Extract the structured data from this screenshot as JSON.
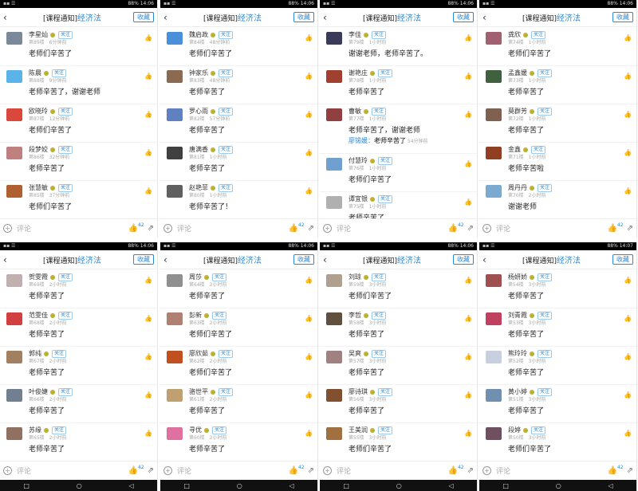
{
  "header": {
    "prefix": "[课程通知]",
    "course": "经济法",
    "fav": "收藏"
  },
  "statusbar": {
    "p1": "88% 14:06",
    "p2": "88% 14:06",
    "p3": "88% 14:06",
    "p4": "88% 14:06",
    "p5": "88% 14:06",
    "p6": "88% 14:06",
    "p7": "88% 14:06",
    "p8": "88% 14:07"
  },
  "follow": "关注",
  "bottom": {
    "placeholder": "评论",
    "likes": "42"
  },
  "panels": [
    {
      "comments": [
        {
          "name": "李星灿",
          "floor": "第89楼",
          "time": "6分钟前",
          "text": "老师们辛苦了",
          "color": "#7a8a9a"
        },
        {
          "name": "陈晨",
          "floor": "第88楼",
          "time": "9分钟前",
          "text": "老师辛苦了，谢谢老师",
          "color": "#5ab4e8"
        },
        {
          "name": "欧晓玲",
          "floor": "第87楼",
          "time": "12分钟前",
          "text": "老师们辛苦了",
          "color": "#d9483b"
        },
        {
          "name": "段梦姣",
          "floor": "第86楼",
          "time": "32分钟前",
          "text": "老师辛苦了",
          "color": "#c08080"
        },
        {
          "name": "张慧敏",
          "floor": "第85楼",
          "time": "37分钟前",
          "text": "老师们辛苦了",
          "color": "#b06030"
        }
      ]
    },
    {
      "comments": [
        {
          "name": "魏启政",
          "floor": "第84楼",
          "time": "48分钟前",
          "text": "老师们辛苦了",
          "color": "#4a90d9"
        },
        {
          "name": "钟家乐",
          "floor": "第83楼",
          "time": "48分钟前",
          "text": "老师辛苦了",
          "color": "#8a6a50"
        },
        {
          "name": "罗心雨",
          "floor": "第82楼",
          "time": "57分钟前",
          "text": "老师辛苦了",
          "color": "#6080c0"
        },
        {
          "name": "唐满香",
          "floor": "第81楼",
          "time": "1小时前",
          "text": "老师辛苦了",
          "color": "#404040"
        },
        {
          "name": "赵艳菲",
          "floor": "第80楼",
          "time": "1小时前",
          "text": "老师辛苦了！",
          "color": "#606060"
        }
      ]
    },
    {
      "comments": [
        {
          "name": "李佳",
          "floor": "第79楼",
          "time": "1小时前",
          "text": "谢谢老师，老师辛苦了。",
          "color": "#3a3a5a"
        },
        {
          "name": "谢艳庄",
          "floor": "第78楼",
          "time": "1小时前",
          "text": "老师辛苦了",
          "color": "#a04030"
        },
        {
          "name": "曹敏",
          "floor": "第77楼",
          "time": "1小时前",
          "text": "老师辛苦了，谢谢老师",
          "color": "#904040",
          "reply": {
            "name": "廖锡媛：",
            "text": "老师辛苦了",
            "time": "54分钟前"
          }
        },
        {
          "name": "付慧玲",
          "floor": "第76楼",
          "time": "1小时前",
          "text": "老师们辛苦了",
          "color": "#70a0d0"
        },
        {
          "name": "谭宜银",
          "floor": "第75楼",
          "time": "1小时前",
          "text": "老师辛苦了",
          "color": "#b0b0b0"
        }
      ]
    },
    {
      "comments": [
        {
          "name": "龚欣",
          "floor": "第74楼",
          "time": "1小时前",
          "text": "老师们辛苦了",
          "color": "#a06070"
        },
        {
          "name": "孟鑫媛",
          "floor": "第73楼",
          "time": "1小时前",
          "text": "老师辛苦了",
          "color": "#406040"
        },
        {
          "name": "莫群芳",
          "floor": "第72楼",
          "time": "1小时前",
          "text": "老师辛苦了",
          "color": "#806050"
        },
        {
          "name": "金鑫",
          "floor": "第71楼",
          "time": "1小时前",
          "text": "老师辛苦啦",
          "color": "#904020"
        },
        {
          "name": "周丹丹",
          "floor": "第70楼",
          "time": "2小时前",
          "text": "谢谢老师",
          "color": "#7aaad0"
        }
      ]
    },
    {
      "comments": [
        {
          "name": "贺雯霞",
          "floor": "第69楼",
          "time": "2小时前",
          "text": "老师辛苦了",
          "color": "#c0b0b0"
        },
        {
          "name": "范雯佳",
          "floor": "第68楼",
          "time": "2小时前",
          "text": "老师辛苦了",
          "color": "#d04040"
        },
        {
          "name": "郭纯",
          "floor": "第67楼",
          "time": "2小时前",
          "text": "老师辛苦了",
          "color": "#a08060"
        },
        {
          "name": "叶俊婕",
          "floor": "第66楼",
          "time": "2小时前",
          "text": "老师辛苦了",
          "color": "#708090"
        },
        {
          "name": "苏缘",
          "floor": "第65楼",
          "time": "2小时前",
          "text": "老师辛苦了",
          "color": "#907060"
        }
      ]
    },
    {
      "comments": [
        {
          "name": "周莎",
          "floor": "第64楼",
          "time": "2小时前",
          "text": "老师辛苦了",
          "color": "#909090"
        },
        {
          "name": "彭新",
          "floor": "第63楼",
          "time": "2小时前",
          "text": "老师们辛苦了",
          "color": "#b08070"
        },
        {
          "name": "廖欣茹",
          "floor": "第62楼",
          "time": "2小时前",
          "text": "老师们辛苦了",
          "color": "#c05020"
        },
        {
          "name": "骆世平",
          "floor": "第61楼",
          "time": "2小时前",
          "text": "老师辛苦了",
          "color": "#c0a070"
        },
        {
          "name": "寻优",
          "floor": "第60楼",
          "time": "2小时前",
          "text": "老师辛苦了",
          "color": "#e070a0"
        }
      ]
    },
    {
      "comments": [
        {
          "name": "刘琼",
          "floor": "第59楼",
          "time": "3小时前",
          "text": "老师们辛苦了",
          "color": "#b0a090"
        },
        {
          "name": "李哲",
          "floor": "第58楼",
          "time": "3小时前",
          "text": "老师辛苦了",
          "color": "#605040"
        },
        {
          "name": "吴爽",
          "floor": "第57楼",
          "time": "3小时前",
          "text": "老师辛苦了",
          "color": "#a08080"
        },
        {
          "name": "廖诗琪",
          "floor": "第56楼",
          "time": "3小时前",
          "text": "老师辛苦了",
          "color": "#805030"
        },
        {
          "name": "王美润",
          "floor": "第55楼",
          "time": "3小时前",
          "text": "老师们辛苦了",
          "color": "#a07040"
        }
      ]
    },
    {
      "comments": [
        {
          "name": "杨妍娇",
          "floor": "第54楼",
          "time": "3小时前",
          "text": "老师辛苦了",
          "color": "#a05050"
        },
        {
          "name": "刘青霞",
          "floor": "第53楼",
          "time": "3小时前",
          "text": "老师辛苦了",
          "color": "#c04060"
        },
        {
          "name": "熊玲玲",
          "floor": "第52楼",
          "time": "3小时前",
          "text": "老师辛苦了",
          "color": "#c8d0e0"
        },
        {
          "name": "黄小婷",
          "floor": "第51楼",
          "time": "3小时前",
          "text": "老师辛苦了",
          "color": "#7090b0"
        },
        {
          "name": "段婷",
          "floor": "第50楼",
          "time": "3小时前",
          "text": "老师们辛苦了",
          "color": "#705060"
        }
      ]
    }
  ]
}
